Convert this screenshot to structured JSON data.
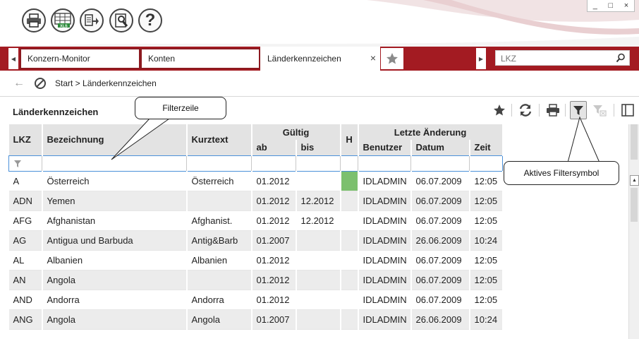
{
  "window": {
    "minimize": "_",
    "maximize": "□",
    "close": "×"
  },
  "toolbar": {
    "icons": [
      "printer-icon",
      "xls-export-icon",
      "export-icon",
      "tools-icon",
      "help-icon"
    ],
    "help_label": "?"
  },
  "tabs": [
    {
      "label": "Konzern-Monitor",
      "active": false
    },
    {
      "label": "Konten",
      "active": false
    },
    {
      "label": "Länderkennzeichen",
      "active": true,
      "close": "×"
    }
  ],
  "search": {
    "placeholder": "LKZ",
    "value": ""
  },
  "breadcrumb": {
    "back": "←",
    "path": "Start > Länderkennzeichen"
  },
  "content": {
    "title": "Länderkennzeichen"
  },
  "colors": {
    "brand": "#a31b22",
    "header_bg": "#e3e3e3",
    "h_flag": "#7cc06e",
    "filter_border": "#4a90d9"
  },
  "table": {
    "headers": {
      "lkz": "LKZ",
      "bezeichnung": "Bezeichnung",
      "kurztext": "Kurztext",
      "gueltig": "Gültig",
      "ab": "ab",
      "bis": "bis",
      "h": "H",
      "letzte": "Letzte Änderung",
      "benutzer": "Benutzer",
      "datum": "Datum",
      "zeit": "Zeit"
    },
    "filter_icon": "filter-icon",
    "rows": [
      {
        "lkz": "A",
        "bezeichnung": "Österreich",
        "kurztext": "Österreich",
        "ab": "01.2012",
        "bis": "",
        "h": true,
        "benutzer": "IDLADMIN",
        "datum": "06.07.2009",
        "zeit": "12:05"
      },
      {
        "lkz": "ADN",
        "bezeichnung": "Yemen",
        "kurztext": "",
        "ab": "01.2012",
        "bis": "12.2012",
        "h": false,
        "benutzer": "IDLADMIN",
        "datum": "06.07.2009",
        "zeit": "12:05"
      },
      {
        "lkz": "AFG",
        "bezeichnung": "Afghanistan",
        "kurztext": "Afghanist.",
        "ab": "01.2012",
        "bis": "12.2012",
        "h": false,
        "benutzer": "IDLADMIN",
        "datum": "06.07.2009",
        "zeit": "12:05"
      },
      {
        "lkz": "AG",
        "bezeichnung": "Antigua und Barbuda",
        "kurztext": "Antig&Barb",
        "ab": "01.2007",
        "bis": "",
        "h": false,
        "benutzer": "IDLADMIN",
        "datum": "26.06.2009",
        "zeit": "10:24"
      },
      {
        "lkz": "AL",
        "bezeichnung": "Albanien",
        "kurztext": "Albanien",
        "ab": "01.2012",
        "bis": "",
        "h": false,
        "benutzer": "IDLADMIN",
        "datum": "06.07.2009",
        "zeit": "12:05"
      },
      {
        "lkz": "AN",
        "bezeichnung": "Angola",
        "kurztext": "",
        "ab": "01.2012",
        "bis": "",
        "h": false,
        "benutzer": "IDLADMIN",
        "datum": "06.07.2009",
        "zeit": "12:05"
      },
      {
        "lkz": "AND",
        "bezeichnung": "Andorra",
        "kurztext": "Andorra",
        "ab": "01.2012",
        "bis": "",
        "h": false,
        "benutzer": "IDLADMIN",
        "datum": "06.07.2009",
        "zeit": "12:05"
      },
      {
        "lkz": "ANG",
        "bezeichnung": "Angola",
        "kurztext": "Angola",
        "ab": "01.2007",
        "bis": "",
        "h": false,
        "benutzer": "IDLADMIN",
        "datum": "26.06.2009",
        "zeit": "10:24"
      }
    ]
  },
  "annotations": {
    "filterzeile": "Filterzeile",
    "aktives_filtersymbol": "Aktives Filtersymbol"
  }
}
